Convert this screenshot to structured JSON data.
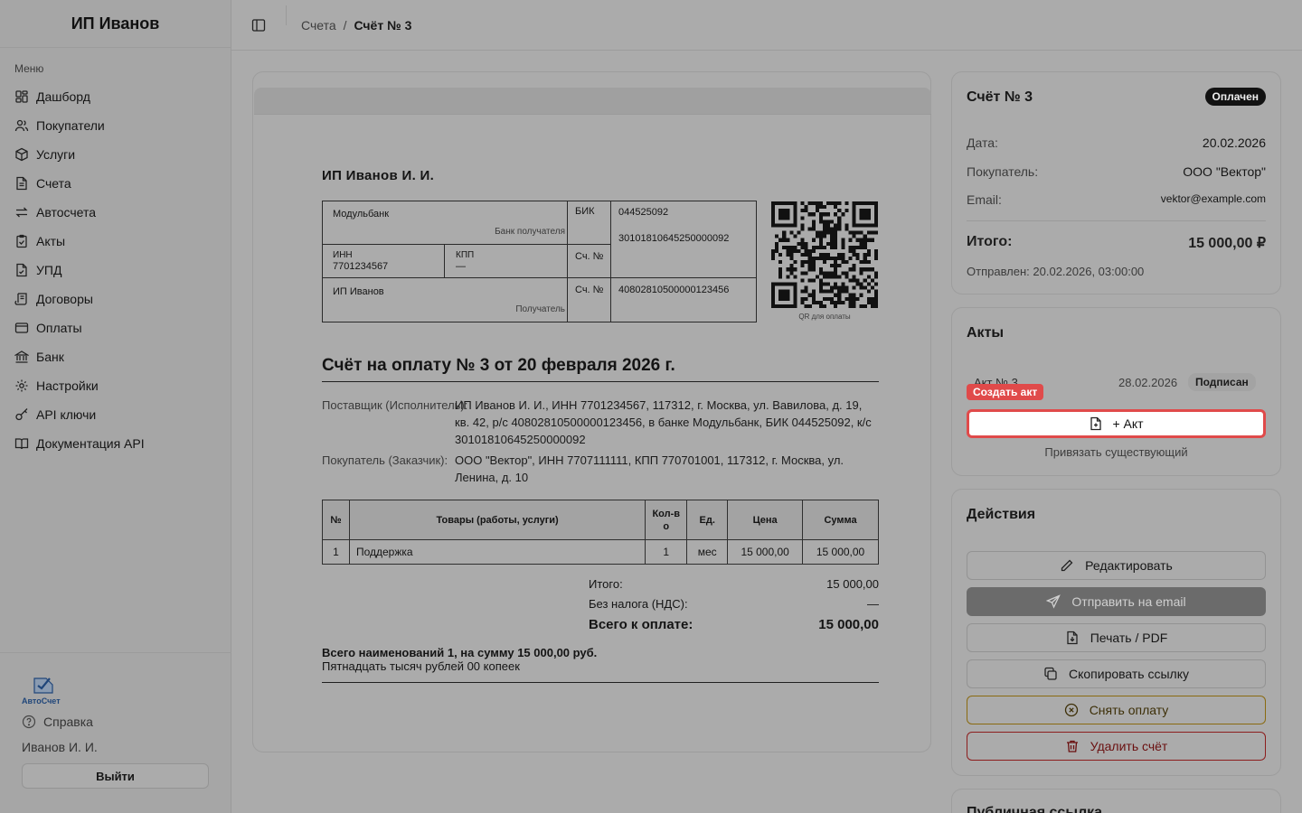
{
  "sidebar": {
    "brand": "ИП Иванов",
    "menu_caption": "Меню",
    "items": [
      {
        "label": "Дашборд",
        "icon": "dashboard-icon"
      },
      {
        "label": "Покупатели",
        "icon": "users-icon"
      },
      {
        "label": "Услуги",
        "icon": "box-icon"
      },
      {
        "label": "Счета",
        "icon": "file-text-icon"
      },
      {
        "label": "Автосчета",
        "icon": "repeat-icon"
      },
      {
        "label": "Акты",
        "icon": "clipboard-check-icon"
      },
      {
        "label": "УПД",
        "icon": "file-check-icon"
      },
      {
        "label": "Договоры",
        "icon": "scroll-icon"
      },
      {
        "label": "Оплаты",
        "icon": "wallet-icon"
      },
      {
        "label": "Банк",
        "icon": "bank-icon"
      },
      {
        "label": "Настройки",
        "icon": "gear-icon"
      },
      {
        "label": "API ключи",
        "icon": "key-icon"
      },
      {
        "label": "Документация API",
        "icon": "book-icon"
      }
    ],
    "logo_text": "АвтоСчет",
    "help": "Справка",
    "user": "Иванов И. И.",
    "logout": "Выйти"
  },
  "header": {
    "breadcrumb_parent": "Счета",
    "breadcrumb_sep": "/",
    "breadcrumb_current": "Счёт № 3"
  },
  "invoice": {
    "seller_title": "ИП Иванов И. И.",
    "bank": {
      "bank_name": "Модульбанк",
      "bank_caption": "Банк получателя",
      "bik_label": "БИК",
      "bik": "044525092",
      "corr_account": "30101810645250000092",
      "inn_label": "ИНН",
      "inn": "7701234567",
      "kpp_label": "КПП",
      "kpp": "—",
      "acc_label": "Сч. №",
      "acc_label2": "Сч. №",
      "account": "40802810500000123456",
      "recipient": "ИП Иванов",
      "recipient_caption": "Получатель"
    },
    "qr_caption": "QR для оплаты",
    "title": "Счёт на оплату № 3 от 20 февраля 2026 г.",
    "supplier_label": "Поставщик (Исполнитель):",
    "supplier_value": "ИП Иванов И. И., ИНН 7701234567, 117312, г. Москва, ул. Вавилова, д. 19, кв. 42, р/с 40802810500000123456, в банке Модульбанк, БИК 044525092, к/с 30101810645250000092",
    "buyer_label": "Покупатель (Заказчик):",
    "buyer_value": "ООО \"Вектор\", ИНН 7707111111, КПП 770701001, 117312, г. Москва, ул. Ленина, д. 10",
    "table": {
      "headers": [
        "№",
        "Товары (работы, услуги)",
        "Кол-во",
        "Ед.",
        "Цена",
        "Сумма"
      ],
      "rows": [
        [
          "1",
          "Поддержка",
          "1",
          "мес",
          "15 000,00",
          "15 000,00"
        ]
      ]
    },
    "totals": {
      "subtotal_label": "Итого:",
      "subtotal": "15 000,00",
      "vat_label": "Без налога (НДС):",
      "vat": "—",
      "total_label": "Всего к оплате:",
      "total": "15 000,00"
    },
    "summary_line": "Всего наименований 1, на сумму 15 000,00 руб.",
    "summary_words": "Пятнадцать тысяч рублей 00 копеек"
  },
  "info_panel": {
    "title": "Счёт № 3",
    "status": "Оплачен",
    "date_label": "Дата:",
    "date": "20.02.2026",
    "buyer_label": "Покупатель:",
    "buyer": "ООО \"Вектор\"",
    "email_label": "Email:",
    "email": "vektor@example.com",
    "total_label": "Итого:",
    "total": "15 000,00 ₽",
    "sent": "Отправлен: 20.02.2026, 03:00:00"
  },
  "acts_panel": {
    "title": "Акты",
    "act_name": "Акт № 3",
    "act_date": "28.02.2026",
    "act_status": "Подписан",
    "tooltip": "Создать акт",
    "add_button": "+ Акт",
    "link_existing": "Привязать существующий"
  },
  "actions_panel": {
    "title": "Действия",
    "edit": "Редактировать",
    "send_email": "Отправить на email",
    "print": "Печать / PDF",
    "copy_link": "Скопировать ссылку",
    "cancel_payment": "Снять оплату",
    "delete": "Удалить счёт"
  },
  "public_panel": {
    "title": "Публичная ссылка"
  },
  "colors": {
    "overlay_bg": "#ababab",
    "highlight_red": "#e04a4a",
    "badge_dark": "#121212"
  }
}
